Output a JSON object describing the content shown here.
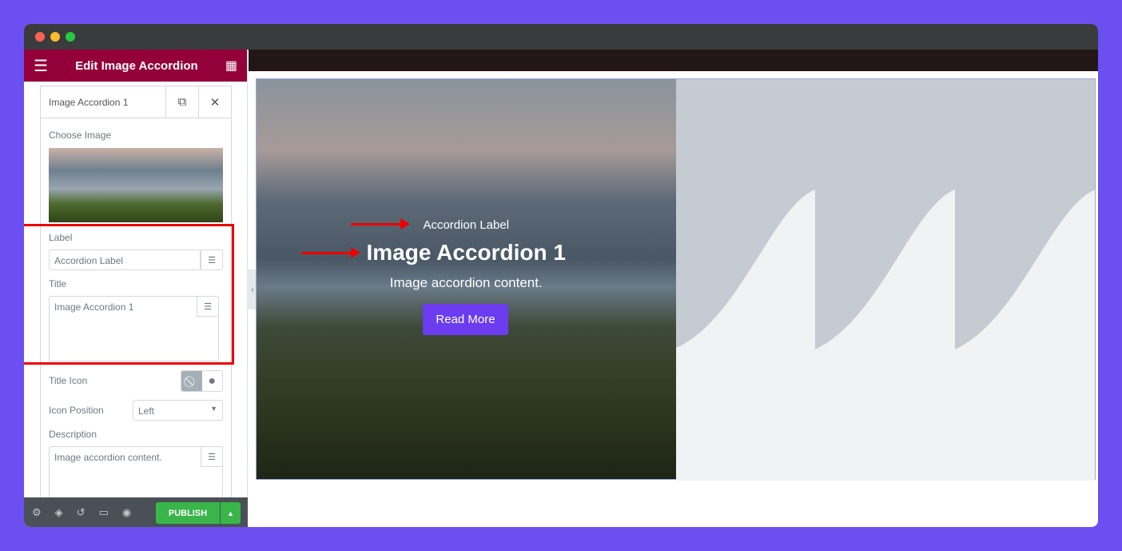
{
  "panel": {
    "title": "Edit Image Accordion",
    "item_title": "Image Accordion 1",
    "choose_image": "Choose Image",
    "label_label": "Label",
    "label_value": "Accordion Label",
    "title_label": "Title",
    "title_value": "Image Accordion 1",
    "title_icon": "Title Icon",
    "icon_position": "Icon Position",
    "icon_position_value": "Left",
    "description": "Description",
    "description_value": "Image accordion content.",
    "publish": "PUBLISH"
  },
  "preview": {
    "label": "Accordion Label",
    "title": "Image Accordion 1",
    "content": "Image accordion content.",
    "button": "Read More"
  },
  "colors": {
    "header": "#93003a",
    "publish": "#39b54a",
    "button": "#6b3cf0",
    "highlight": "#e00000"
  }
}
